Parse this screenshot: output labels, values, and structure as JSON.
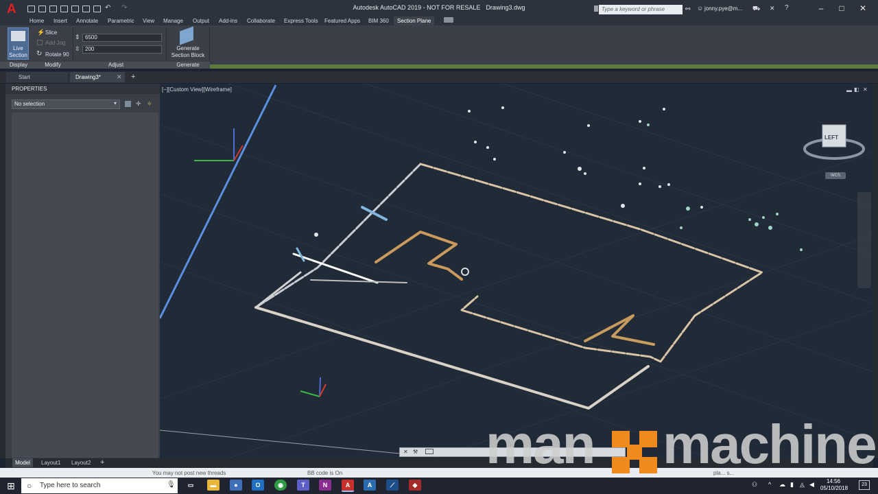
{
  "window": {
    "app_title": "Autodesk AutoCAD 2019 - NOT FOR RESALE",
    "file_name": "Drawing3.dwg",
    "search_placeholder": "Type a keyword or phrase",
    "user": "jonny.pye@m..."
  },
  "ribbon_tabs": [
    "Home",
    "Insert",
    "Annotate",
    "Parametric",
    "View",
    "Manage",
    "Output",
    "Add-ins",
    "Collaborate",
    "Express Tools",
    "Featured Apps",
    "BIM 360",
    "Section Plane"
  ],
  "ribbon": {
    "live_section": "Live Section",
    "slice": "Slice",
    "add_jog": "Add Jog",
    "rotate90": "Rotate 90",
    "input_1": "6500",
    "input_2": "200",
    "generate": "Generate Section Block",
    "panels": {
      "display": "Display",
      "modify": "Modify",
      "adjust": "Adjust",
      "generate": "Generate"
    }
  },
  "doc_tabs": {
    "start": "Start",
    "drawing": "Drawing3*"
  },
  "properties": {
    "title": "PROPERTIES",
    "selection": "No selection"
  },
  "viewport": {
    "label": "[−][Custom View][Wireframe]",
    "viewcube_face": "LEFT",
    "wcs": "WCS"
  },
  "layout_tabs": [
    "Model",
    "Layout1",
    "Layout2"
  ],
  "status_strip": {
    "left": "You may not post new threads",
    "mid": "BB code is On",
    "right": "pla... s..."
  },
  "watermark": {
    "text_left": "man",
    "text_right": "machine"
  },
  "taskbar": {
    "search": "Type here to search",
    "time": "14:56",
    "date": "05/10/2018",
    "notif": "23"
  },
  "colors": {
    "accent_orange": "#f08a1c",
    "viewport_bg": "#212a37",
    "ribbon_bg": "#3b4048"
  }
}
